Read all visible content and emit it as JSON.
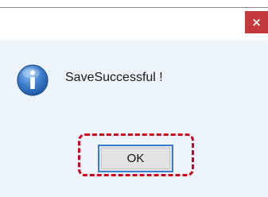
{
  "dialog": {
    "close_glyph": "×",
    "message": "SaveSuccessful !",
    "ok_label": "OK",
    "icon": "information-icon"
  },
  "colors": {
    "close_button": "#c23a3a",
    "dialog_background": "#eef4fb",
    "highlight_border": "#d0021b",
    "ok_button_focus_border": "#3a7bd5",
    "icon_blue": "#2e6bb8"
  }
}
